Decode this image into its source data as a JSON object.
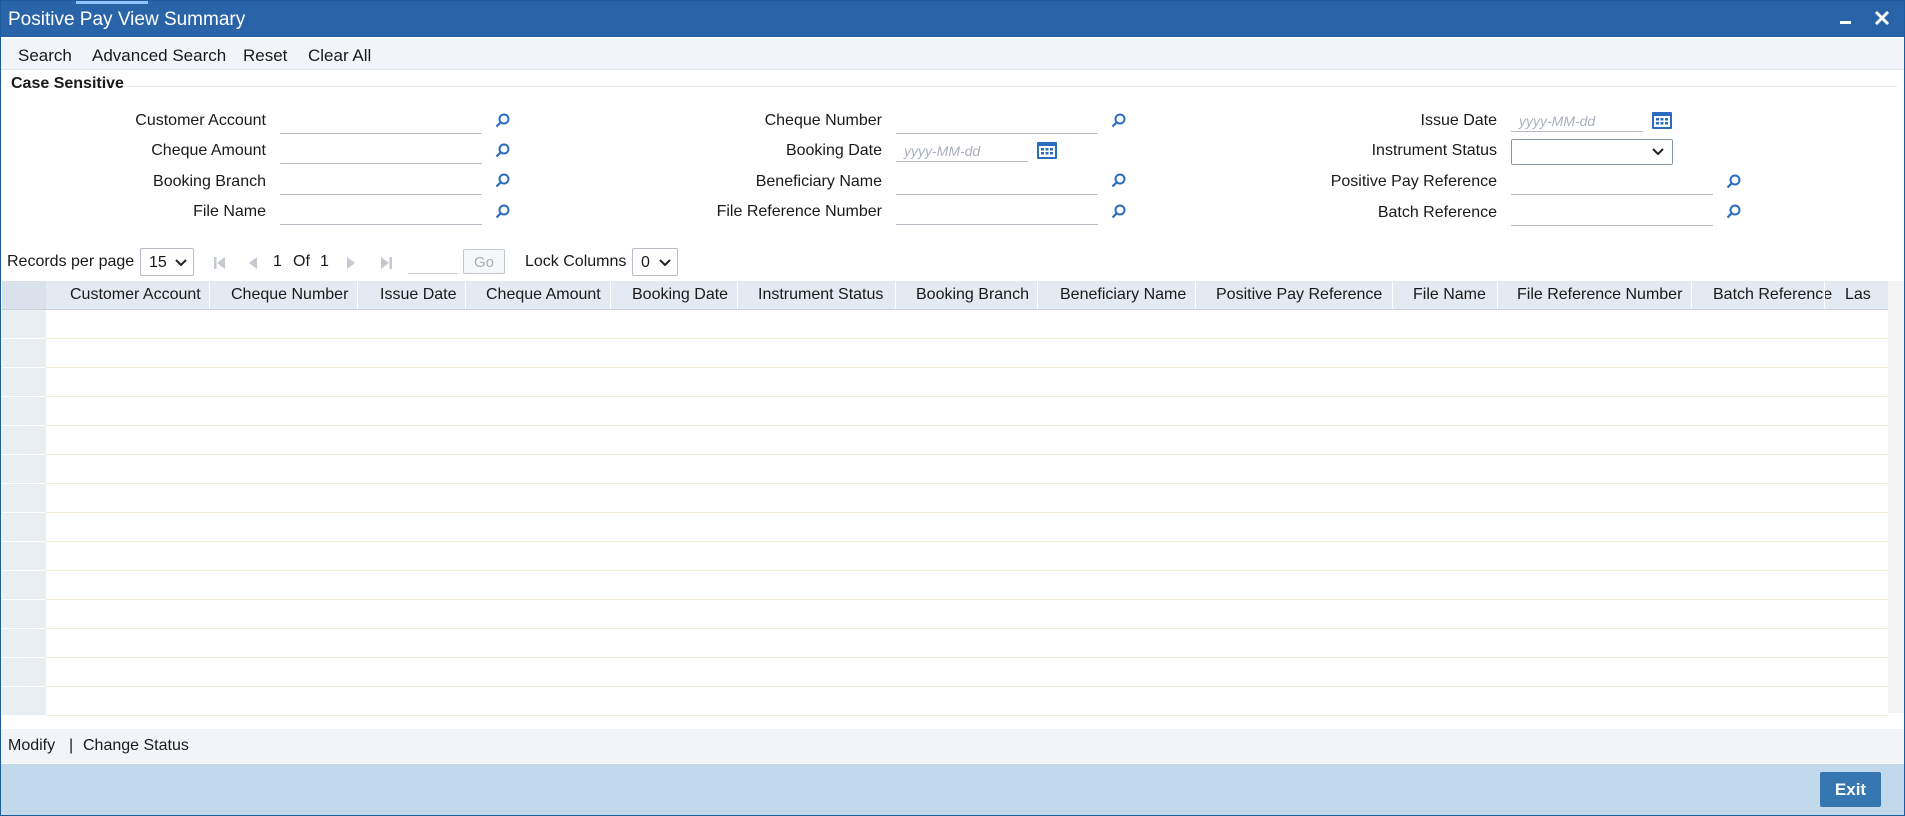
{
  "window": {
    "title": "Positive Pay View Summary"
  },
  "menu": {
    "search": "Search",
    "advanced_search": "Advanced Search",
    "reset": "Reset",
    "clear_all": "Clear All"
  },
  "section": {
    "title": "Case Sensitive"
  },
  "fields": {
    "customer_account": "Customer Account",
    "cheque_amount": "Cheque Amount",
    "booking_branch": "Booking Branch",
    "file_name": "File Name",
    "cheque_number": "Cheque Number",
    "booking_date": "Booking Date",
    "beneficiary_name": "Beneficiary Name",
    "file_reference_number": "File Reference Number",
    "issue_date": "Issue Date",
    "instrument_status": "Instrument Status",
    "positive_pay_reference": "Positive Pay Reference",
    "batch_reference": "Batch Reference",
    "date_placeholder": "yyyy-MM-dd",
    "instrument_status_value": ""
  },
  "pager": {
    "records_per_page_label": "Records per page",
    "records_per_page_value": "15",
    "current_page": "1",
    "of_label": "Of",
    "total_pages": "1",
    "go_label": "Go",
    "lock_columns_label": "Lock Columns",
    "lock_columns_value": "0"
  },
  "grid": {
    "columns": [
      "Customer Account",
      "Cheque Number",
      "Issue Date",
      "Cheque Amount",
      "Booking Date",
      "Instrument Status",
      "Booking Branch",
      "Beneficiary Name",
      "Positive Pay Reference",
      "File Name",
      "File Reference Number",
      "Batch Reference",
      "Las"
    ],
    "row_count": 14
  },
  "footer": {
    "modify": "Modify",
    "separator": "|",
    "change_status": "Change Status",
    "exit": "Exit"
  },
  "colors": {
    "titlebar": "#2a64a8",
    "exit_button": "#3676b1",
    "bottom_bar": "#c2d9ec",
    "icon": "#2a6cc0"
  }
}
